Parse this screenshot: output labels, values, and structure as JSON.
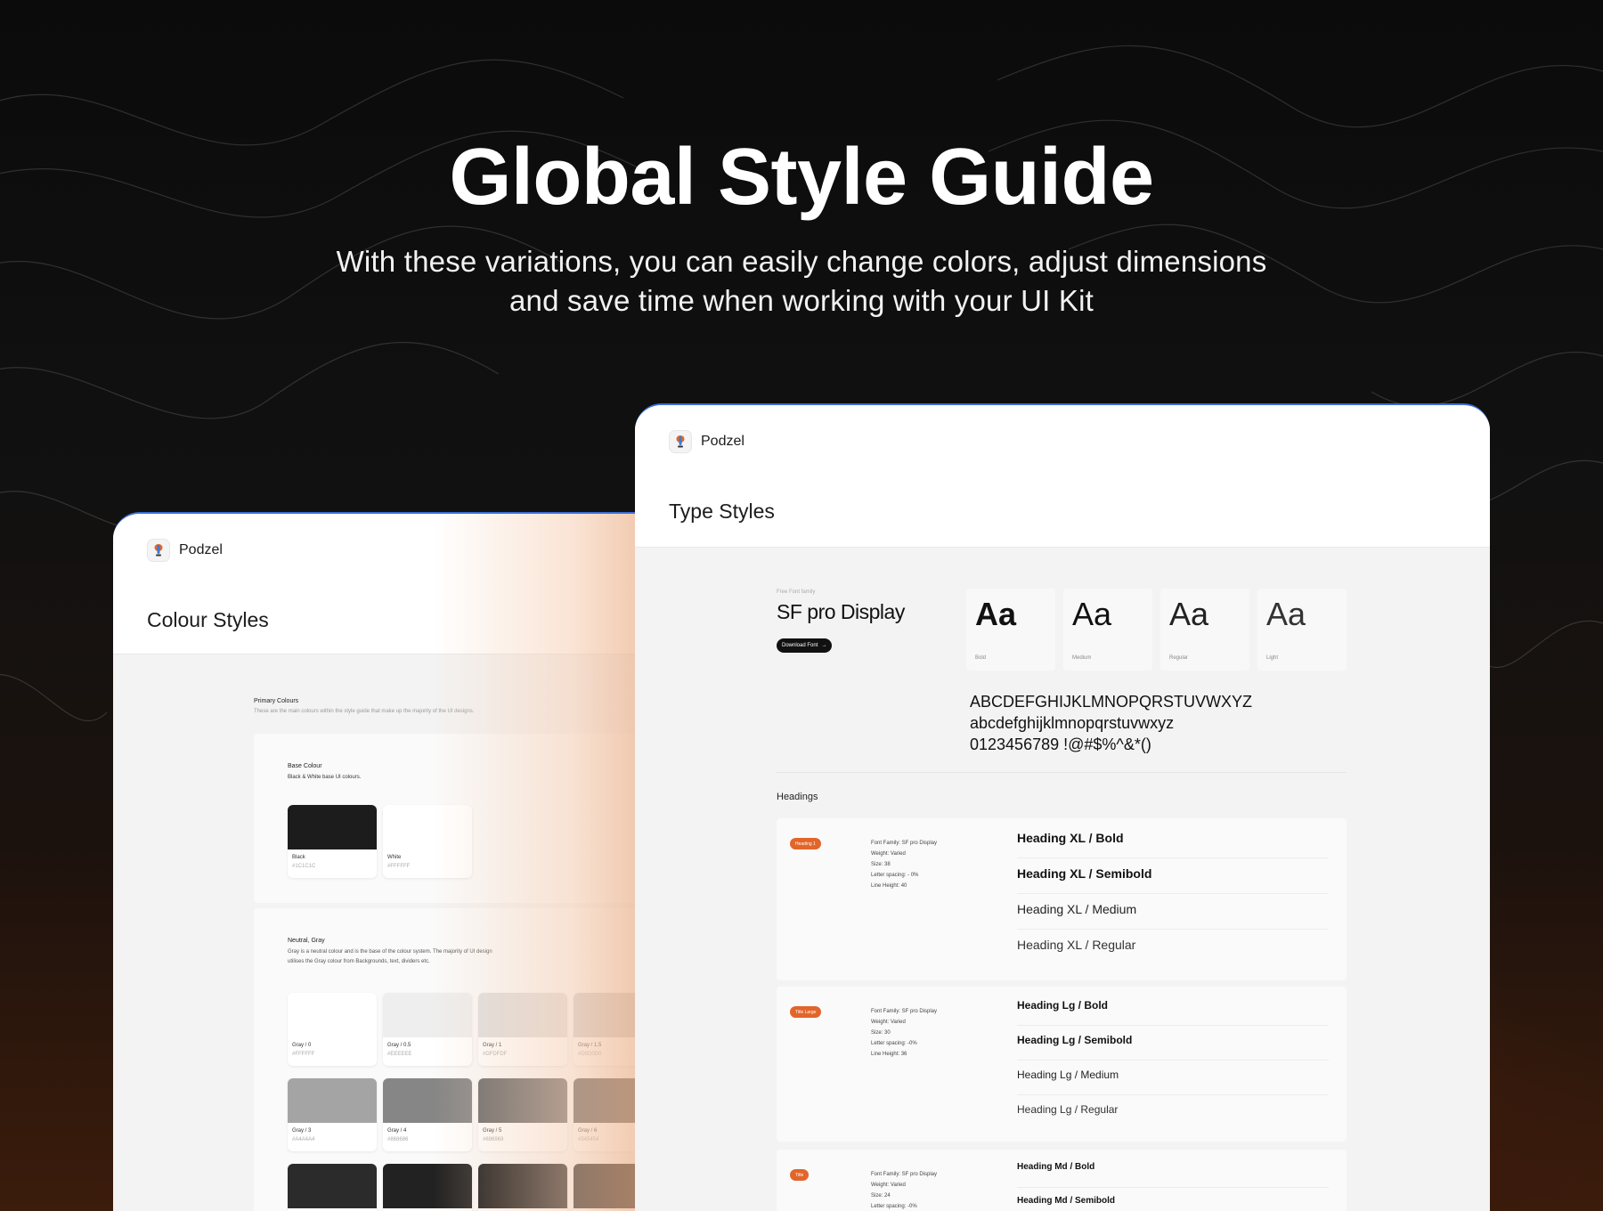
{
  "hero": {
    "title": "Global Style Guide",
    "subtitle_line1": "With these variations, you can easily change colors, adjust dimensions",
    "subtitle_line2": "and save time when working with your UI Kit"
  },
  "colors": {
    "accent": "#e2652a",
    "border_blue": "#3c6fd8"
  },
  "colour_card": {
    "brand": "Podzel",
    "title": "Colour Styles",
    "primary": {
      "title": "Primary Colours",
      "desc": "These are the main colours within the style guide that make up the majority of the UI designs."
    },
    "base": {
      "title": "Base Colour",
      "desc": "Black & White base UI colours.",
      "swatches": [
        {
          "name": "Black",
          "hex": "#1C1C1C",
          "color": "#1C1C1C"
        },
        {
          "name": "White",
          "hex": "#FFFFFF",
          "color": "#FFFFFF"
        }
      ]
    },
    "neutral": {
      "title": "Neutral, Gray",
      "desc_line1": "Gray is a neutral colour and is the base of the colour system. The majority of UI design",
      "desc_line2": "utilises the Gray colour from Backgrounds, text, dividers etc.",
      "swatches": [
        {
          "name": "Gray / 0",
          "hex": "#FFFFFF",
          "color": "#FFFFFF"
        },
        {
          "name": "Gray / 0.5",
          "hex": "#EEEEEE",
          "color": "#EEEEEE"
        },
        {
          "name": "Gray / 1",
          "hex": "#DFDFDF",
          "color": "#DFDFDF"
        },
        {
          "name": "Gray / 1.5",
          "hex": "#D0D0D0",
          "color": "#D0D0D0"
        },
        {
          "name": "Gray / 3",
          "hex": "#A4A4A4",
          "color": "#A4A4A4"
        },
        {
          "name": "Gray / 4",
          "hex": "#868686",
          "color": "#868686"
        },
        {
          "name": "Gray / 5",
          "hex": "#696969",
          "color": "#696969"
        },
        {
          "name": "Gray / 6",
          "hex": "#545454",
          "color": "#545454"
        },
        {
          "name": "",
          "hex": "",
          "color": "#2B2B2B"
        },
        {
          "name": "",
          "hex": "",
          "color": "#222222"
        },
        {
          "name": "",
          "hex": "",
          "color": "#181818"
        },
        {
          "name": "",
          "hex": "",
          "color": "#111111"
        }
      ]
    }
  },
  "type_card": {
    "brand": "Podzel",
    "title": "Type Styles",
    "font_family_label": "Free Font family",
    "font_name": "SF pro Display",
    "download_label": "Download Font",
    "weights": [
      {
        "sample": "Aa",
        "label": "Bold"
      },
      {
        "sample": "Aa",
        "label": "Medium"
      },
      {
        "sample": "Aa",
        "label": "Regular"
      },
      {
        "sample": "Aa",
        "label": "Light"
      }
    ],
    "upper": "ABCDEFGHIJKLMNOPQRSTUVWXYZ",
    "lower": "abcdefghijklmnopqrstuvwxyz",
    "digits": "0123456789 !@#$%^&*()",
    "headings_label": "Headings",
    "groups": [
      {
        "badge": "Heading 1",
        "specs": [
          "Font Family: SF pro Display",
          "Weight: Varied",
          "Size: 38",
          "Letter spacing: - 0%",
          "Line Height: 40"
        ],
        "samples": [
          "Heading XL / Bold",
          "Heading XL / Semibold",
          "Heading XL / Medium",
          "Heading XL / Regular"
        ]
      },
      {
        "badge": "Title Large",
        "specs": [
          "Font Family: SF pro Display",
          "Weight: Varied",
          "Size: 30",
          "Letter spacing: -0%",
          "Line Height: 36"
        ],
        "samples": [
          "Heading Lg / Bold",
          "Heading Lg / Semibold",
          "Heading Lg / Medium",
          "Heading Lg / Regular"
        ]
      },
      {
        "badge": "Title",
        "specs": [
          "Font Family: SF pro Display",
          "Weight: Varied",
          "Size: 24",
          "Letter spacing: -0%"
        ],
        "samples": [
          "Heading Md / Bold",
          "Heading Md / Semibold"
        ]
      }
    ]
  }
}
